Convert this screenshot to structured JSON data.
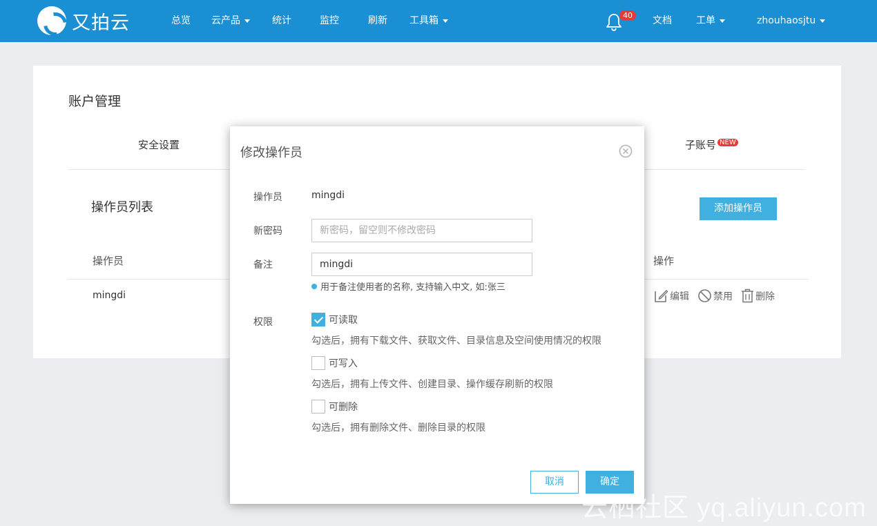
{
  "header": {
    "brand": "又拍云",
    "nav": {
      "overview": "总览",
      "products": "云产品",
      "stats": "统计",
      "monitor": "监控",
      "refresh": "刷新",
      "toolbox": "工具箱"
    },
    "notification_count": "40",
    "docs": "文档",
    "tickets": "工单",
    "username": "zhouhaosjtu"
  },
  "page": {
    "title": "账户管理",
    "tabs": {
      "security": "安全设置",
      "subaccount": "子账号",
      "subaccount_badge": "NEW"
    },
    "operators": {
      "title": "操作员列表",
      "add_button": "添加操作员",
      "columns": {
        "operator": "操作员",
        "actions": "操作"
      },
      "rows": [
        {
          "name": "mingdi",
          "edit": "编辑",
          "disable": "禁用",
          "delete": "删除"
        }
      ]
    }
  },
  "modal": {
    "title": "修改操作员",
    "operator_label": "操作员",
    "operator_value": "mingdi",
    "password_label": "新密码",
    "password_placeholder": "新密码，留空则不修改密码",
    "note_label": "备注",
    "note_value": "mingdi",
    "note_hint": "用于备注使用者的名称, 支持输入中文, 如:张三",
    "permissions_label": "权限",
    "permissions": [
      {
        "label": "可读取",
        "checked": true,
        "desc": "勾选后，拥有下载文件、获取文件、目录信息及空间使用情况的权限"
      },
      {
        "label": "可写入",
        "checked": false,
        "desc": "勾选后，拥有上传文件、创建目录、操作缓存刷新的权限"
      },
      {
        "label": "可删除",
        "checked": false,
        "desc": "勾选后，拥有删除文件、删除目录的权限"
      }
    ],
    "cancel": "取消",
    "confirm": "确定"
  },
  "watermark": "云栖社区 yq.aliyun.com",
  "colors": {
    "header_bg": "#1a8fd3",
    "accent": "#3fb0e0",
    "badge": "#e43b3b",
    "page_bg": "#ebedf0"
  }
}
